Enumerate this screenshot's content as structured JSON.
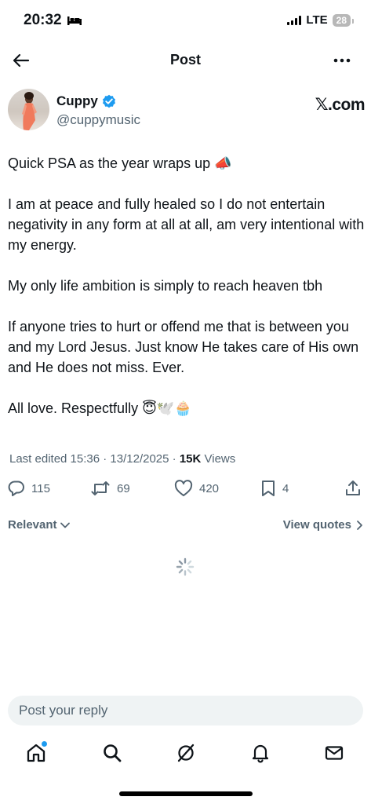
{
  "status_bar": {
    "time": "20:32",
    "network": "LTE",
    "battery": "28"
  },
  "nav": {
    "title": "Post"
  },
  "author": {
    "name": "Cuppy",
    "handle": "@cuppymusic",
    "source": "𝕏.com",
    "verified_color": "#1d9bf0"
  },
  "post": {
    "paragraphs": [
      "Quick PSA as the year wraps up 📣",
      "I am at peace and fully healed so I do not entertain negativity in any form at all at all, am very intentional with my energy.",
      "My only life ambition is simply to reach heaven tbh",
      "If anyone tries to hurt or offend me that is between you and my Lord Jesus. Just know He takes care of His own and He does not miss. Ever.",
      "All love. Respectfully 😇🕊️🧁"
    ],
    "edited_label": "Last edited 15:36 · 13/12/2025 · ",
    "views_count": "15K",
    "views_label": " Views"
  },
  "actions": {
    "replies": "115",
    "reposts": "69",
    "likes": "420",
    "bookmarks": "4"
  },
  "sort": {
    "relevant_label": "Relevant",
    "view_quotes_label": "View quotes"
  },
  "reply": {
    "placeholder": "Post your reply"
  },
  "colors": {
    "accent": "#1d9bf0",
    "secondary_text": "#536471",
    "primary_text": "#0f1419"
  }
}
